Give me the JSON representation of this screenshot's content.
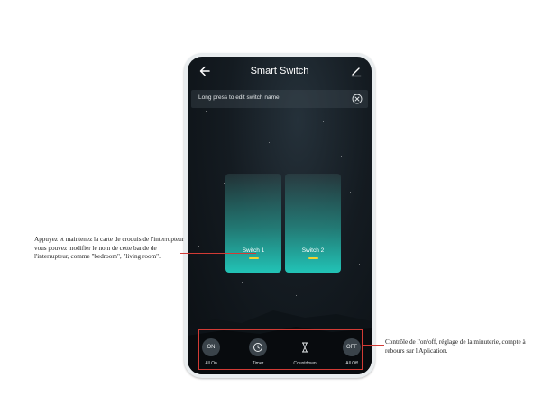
{
  "app": {
    "title": "Smart Switch",
    "hint": "Long press to edit switch name",
    "icons": {
      "back": "back-arrow-icon",
      "edit": "pencil-icon",
      "close": "close-circle-icon"
    }
  },
  "switches": [
    {
      "label": "Switch 1"
    },
    {
      "label": "Switch 2"
    }
  ],
  "controls": [
    {
      "symbol": "ON",
      "label": "All On",
      "icon": "power-on-icon"
    },
    {
      "symbol": "",
      "label": "Timer",
      "icon": "clock-icon"
    },
    {
      "symbol": "",
      "label": "Countdown",
      "icon": "hourglass-icon"
    },
    {
      "symbol": "OFF",
      "label": "All Off",
      "icon": "power-off-icon"
    }
  ],
  "annotations": {
    "left": "Appuyez et maintenez la carte de croquis de l'interrupteur vous pouvez modifier le nom de cette bande de l'interrupteur, comme \"bedroom\", \"living room\".",
    "right": "Contrôle de l'on/off, réglage de la minuterie, compte à rebours sur l'Aplication."
  },
  "colors": {
    "accent": "#22c3b6",
    "indicator": "#f3d430",
    "annotation": "#d23b35"
  }
}
